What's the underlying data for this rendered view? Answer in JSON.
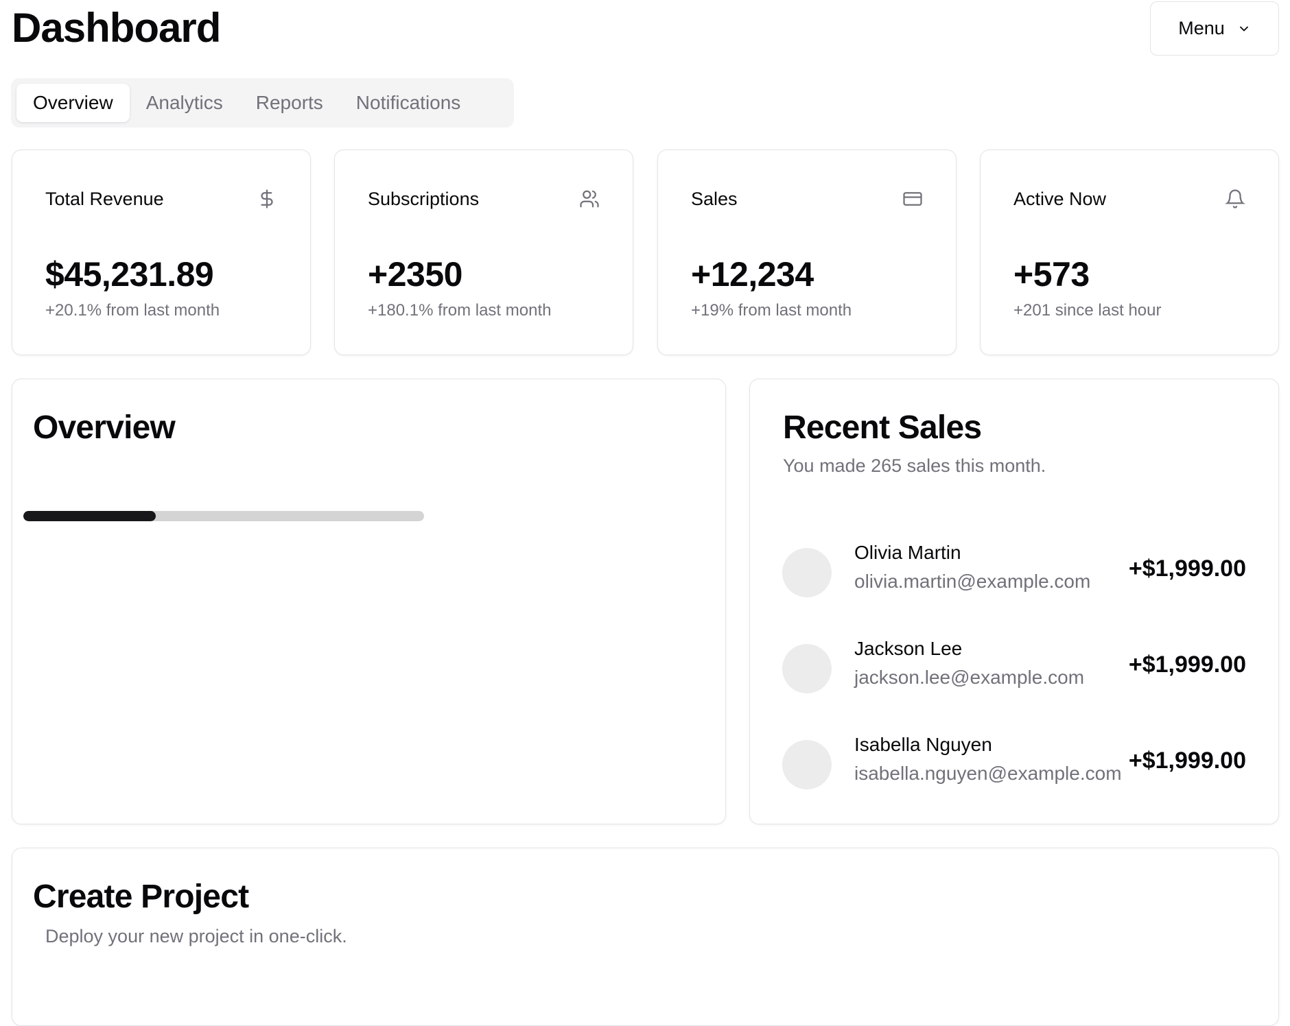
{
  "header": {
    "title": "Dashboard",
    "menu_label": "Menu"
  },
  "tabs": [
    {
      "label": "Overview",
      "active": true
    },
    {
      "label": "Analytics"
    },
    {
      "label": "Reports"
    },
    {
      "label": "Notifications"
    }
  ],
  "stats": [
    {
      "label": "Total Revenue",
      "icon": "dollar-icon",
      "value": "$45,231.89",
      "sub": "+20.1% from last month"
    },
    {
      "label": "Subscriptions",
      "icon": "users-icon",
      "value": "+2350",
      "sub": "+180.1% from last month"
    },
    {
      "label": "Sales",
      "icon": "credit-card-icon",
      "value": "+12,234",
      "sub": "+19% from last month"
    },
    {
      "label": "Active Now",
      "icon": "bell-icon",
      "value": "+573",
      "sub": "+201 since last hour"
    }
  ],
  "overview": {
    "title": "Overview",
    "progress_percent": 33
  },
  "recent_sales": {
    "title": "Recent Sales",
    "subtitle": "You made 265 sales this month.",
    "items": [
      {
        "name": "Olivia Martin",
        "email": "olivia.martin@example.com",
        "amount": "+$1,999.00"
      },
      {
        "name": "Jackson Lee",
        "email": "jackson.lee@example.com",
        "amount": "+$1,999.00"
      },
      {
        "name": "Isabella Nguyen",
        "email": "isabella.nguyen@example.com",
        "amount": "+$1,999.00"
      }
    ]
  },
  "create_project": {
    "title": "Create Project",
    "subtitle": "Deploy your new project in one-click."
  },
  "colors": {
    "text": "#09090b",
    "muted": "#71717a",
    "border": "#e4e4e7",
    "progress_fill": "#18181b",
    "progress_track": "#d4d4d4"
  }
}
